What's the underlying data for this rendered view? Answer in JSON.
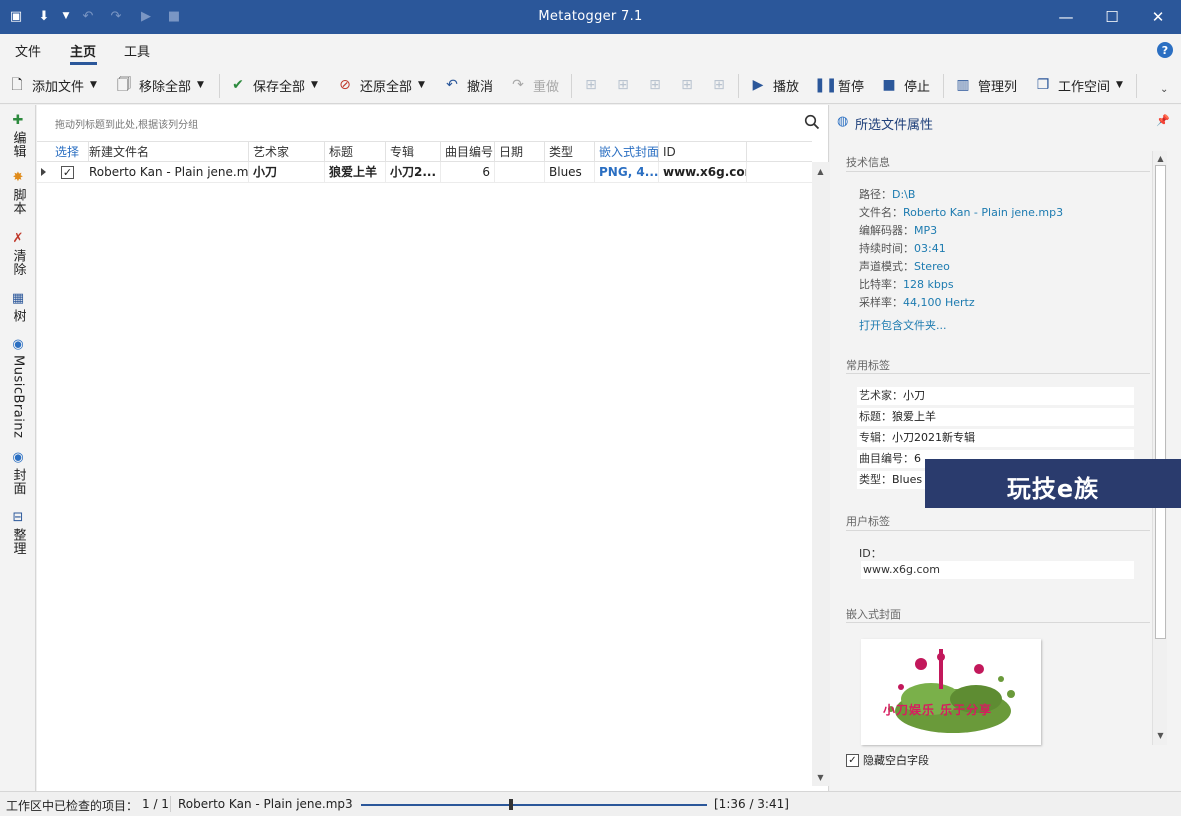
{
  "app": {
    "title": "Metatogger 7.1"
  },
  "ribbon": {
    "tabs": [
      {
        "label": "文件"
      },
      {
        "label": "主页"
      },
      {
        "label": "工具"
      }
    ],
    "active_tab": "主页"
  },
  "toolbar": {
    "add_file": "添加文件",
    "remove_all": "移除全部",
    "save_all": "保存全部",
    "restore_all": "还原全部",
    "undo": "撤消",
    "redo": "重做",
    "play": "播放",
    "pause": "暂停",
    "stop": "停止",
    "manage_columns": "管理列",
    "workspace": "工作空间"
  },
  "leftnav": [
    {
      "label": "编辑",
      "icon": "edit-tag-icon"
    },
    {
      "label": "脚本",
      "icon": "script-icon"
    },
    {
      "label": "清除",
      "icon": "clean-icon"
    },
    {
      "label": "树",
      "icon": "tree-icon"
    },
    {
      "label": "MusicBrainz",
      "icon": "musicbrainz-icon"
    },
    {
      "label": "封面",
      "icon": "cover-icon"
    },
    {
      "label": "整理",
      "icon": "organize-icon"
    }
  ],
  "grid": {
    "group_hint": "拖动列标题到此处,根据该列分组",
    "columns": [
      {
        "label": "选择"
      },
      {
        "label": "新建文件名"
      },
      {
        "label": "艺术家"
      },
      {
        "label": "标题"
      },
      {
        "label": "专辑"
      },
      {
        "label": "曲目编号"
      },
      {
        "label": "日期"
      },
      {
        "label": "类型"
      },
      {
        "label": "嵌入式封面"
      },
      {
        "label": "ID"
      }
    ],
    "rows": [
      {
        "selected": true,
        "filename": "Roberto Kan - Plain jene.mp3",
        "artist": "小刀",
        "title": "狼爱上羊",
        "album": "小刀2...",
        "track": "6",
        "date": "",
        "genre": "Blues",
        "cover": "PNG, 4...",
        "id": "www.x6g.com"
      }
    ]
  },
  "panel": {
    "title": "所选文件属性",
    "tech_section": "技术信息",
    "tech": [
      {
        "key": "路径：",
        "value": "D:\\B"
      },
      {
        "key": "文件名：",
        "value": "Roberto Kan - Plain jene.mp3"
      },
      {
        "key": "编解码器：",
        "value": "MP3"
      },
      {
        "key": "持续时间：",
        "value": "03:41"
      },
      {
        "key": "声道模式：",
        "value": "Stereo"
      },
      {
        "key": "比特率：",
        "value": "128 kbps"
      },
      {
        "key": "采样率：",
        "value": "44,100 Hertz"
      }
    ],
    "open_folder": "打开包含文件夹...",
    "common_section": "常用标签",
    "common": [
      {
        "key": "艺术家：",
        "value": "小刀"
      },
      {
        "key": "标题：",
        "value": "狼爱上羊"
      },
      {
        "key": "专辑：",
        "value": "小刀2021新专辑"
      },
      {
        "key": "曲目编号：",
        "value": "6"
      },
      {
        "key": "类型：",
        "value": "Blues"
      }
    ],
    "user_section": "用户标签",
    "user_id_label": "ID：",
    "user_id_value": "www.x6g.com",
    "cover_section": "嵌入式封面",
    "cover_art_text": "小刀娱乐  乐于分享",
    "hide_empty": "隐藏空白字段",
    "hide_empty_checked": true
  },
  "watermark": {
    "text": "玩技e族"
  },
  "status": {
    "checked_label": "工作区中已检查的项目：",
    "checked_count": "1 / 1",
    "now_playing": "Roberto Kan - Plain jene.mp3",
    "position": "[1:36 / 3:41]",
    "progress": 0.434
  },
  "colors": {
    "titlebar": "#2b579a",
    "accent": "#2b6fc2",
    "link": "#1d7bb0",
    "watermark_bg": "#2a3b6d"
  }
}
